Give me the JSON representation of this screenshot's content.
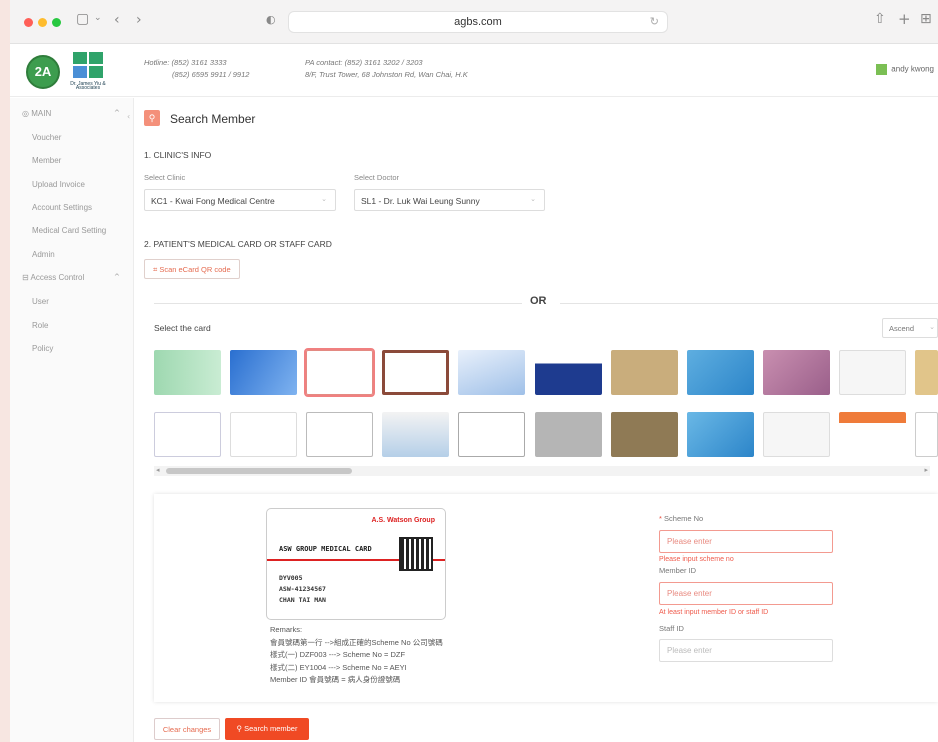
{
  "browser": {
    "url": "agbs.com",
    "colors": {
      "close": "#ff5f57",
      "minimize": "#febc2e",
      "maximize": "#28c840"
    }
  },
  "header": {
    "logo1_text": "2A",
    "logo2_caption": "Dr. James Yiu & Associates",
    "hotline_line1": "Hotline: (852) 3161 3333",
    "hotline_line2": "(852) 6595 9911 / 9912",
    "pa_line1": "PA contact: (852) 3161 3202 / 3203",
    "pa_line2": "8/F, Trust Tower, 68 Johnston Rd, Wan Chai, H.K",
    "user_name": "andy kwong"
  },
  "sidebar": {
    "main_label": "MAIN",
    "items": [
      "Voucher",
      "Member",
      "Upload Invoice",
      "Account Settings",
      "Medical Card Setting",
      "Admin"
    ],
    "access_label": "Access Control",
    "access_items": [
      "User",
      "Role",
      "Policy"
    ]
  },
  "page": {
    "title": "Search Member",
    "section1": "1. CLINIC'S INFO",
    "clinic_label": "Select Clinic",
    "clinic_value": "KC1 - Kwai Fong Medical Centre",
    "doctor_label": "Select Doctor",
    "doctor_value": "SL1 - Dr. Luk Wai Leung Sunny",
    "section2": "2. PATIENT'S MEDICAL CARD OR STAFF CARD",
    "scan_button": "Scan eCard QR code",
    "or_text": "OR",
    "select_card_label": "Select the card",
    "sort_value": "Ascend"
  },
  "selected_card": {
    "brand": "A.S. Watson Group",
    "title": "ASW GROUP MEDICAL CARD",
    "line1": "DYV005",
    "line2": "ASW-41234567",
    "line3": "CHAN TAI MAN"
  },
  "remarks": {
    "heading": "Remarks:",
    "line1": "會員號碼第一行 -->組成正確的Scheme No 公司號碼",
    "line2": "樣式(一) DZF003 ---> Scheme No = DZF",
    "line3": "樣式(二) EY1004 ---> Scheme No = AEYI",
    "line4": "Member ID 會員號碼 = 病人身份證號碼"
  },
  "form": {
    "scheme_label": "Scheme No",
    "scheme_placeholder": "Please enter",
    "scheme_error": "Please input scheme no",
    "member_label": "Member ID",
    "member_placeholder": "Please enter",
    "member_error": "At least input member ID or staff ID",
    "staff_label": "Staff ID",
    "staff_placeholder": "Please enter"
  },
  "actions": {
    "clear": "Clear changes",
    "search": "Search member"
  },
  "colors": {
    "accent": "#f04a24",
    "error": "#ef5b4c"
  }
}
